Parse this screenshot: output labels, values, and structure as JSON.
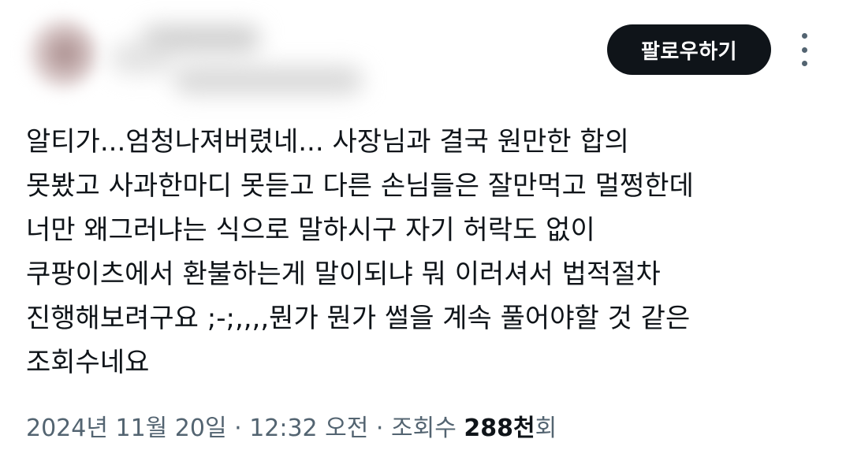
{
  "author": {
    "avatar_icon": "blurred-avatar",
    "name_blurred": true
  },
  "actions": {
    "follow_label": "팔로우하기",
    "more_icon": "more-vertical-icon"
  },
  "tweet": {
    "lines": [
      "알티가...엄청나져버렸네... 사장님과 결국 원만한 합의",
      "못봤고 사과한마디 못듣고 다른 손님들은 잘만먹고 멀쩡한데",
      "너만 왜그러냐는 식으로 말하시구 자기 허락도 없이",
      "쿠팡이츠에서 환불하는게 말이되냐 뭐 이러셔서 법적절차",
      "진행해보려구요 ;-;,,,,뭔가 뭔가 썰을 계속 풀어야할 것 같은",
      "조회수네요"
    ]
  },
  "meta": {
    "date": "2024년 11월 20일",
    "separator1": " · ",
    "time": "12:32 오전",
    "separator2": " · ",
    "views_label": "조회수 ",
    "views_count": "288천",
    "views_suffix": "회"
  },
  "colors": {
    "text_primary": "#0f1419",
    "text_secondary": "#536471",
    "button_bg": "#0f1419",
    "button_text": "#ffffff"
  }
}
